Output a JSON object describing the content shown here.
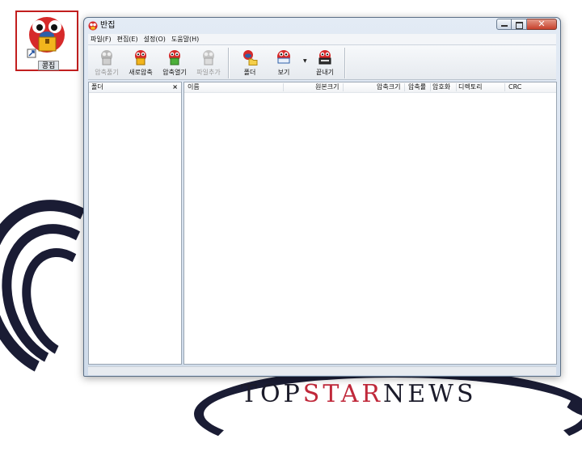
{
  "desktop": {
    "shortcut_label": "콩집",
    "wallpaper_text_start": "TOP",
    "wallpaper_text_accent": "STAR",
    "wallpaper_text_end": "NEWS"
  },
  "window": {
    "title": "반집",
    "close_glyph": "✕"
  },
  "menu": {
    "items": [
      "파일(F)",
      "편집(E)",
      "설정(O)",
      "도움말(H)"
    ]
  },
  "toolbar": {
    "buttons": [
      {
        "label": "압축풀기",
        "enabled": false,
        "icon": "extract-icon"
      },
      {
        "label": "새로압축",
        "enabled": true,
        "icon": "new-archive-icon"
      },
      {
        "label": "압축열기",
        "enabled": true,
        "icon": "open-archive-icon"
      },
      {
        "label": "파일추가",
        "enabled": false,
        "icon": "add-file-icon"
      },
      {
        "label": "폴더",
        "enabled": true,
        "icon": "folder-icon"
      },
      {
        "label": "보기",
        "enabled": true,
        "icon": "view-icon"
      },
      {
        "label": "끝내기",
        "enabled": true,
        "icon": "exit-icon"
      }
    ]
  },
  "folder_pane": {
    "title": "폴더",
    "close_glyph": "×"
  },
  "list": {
    "columns": [
      "이름",
      "원본크기",
      "압축크기",
      "압축률",
      "암호화",
      "디렉토리",
      "CRC"
    ]
  }
}
